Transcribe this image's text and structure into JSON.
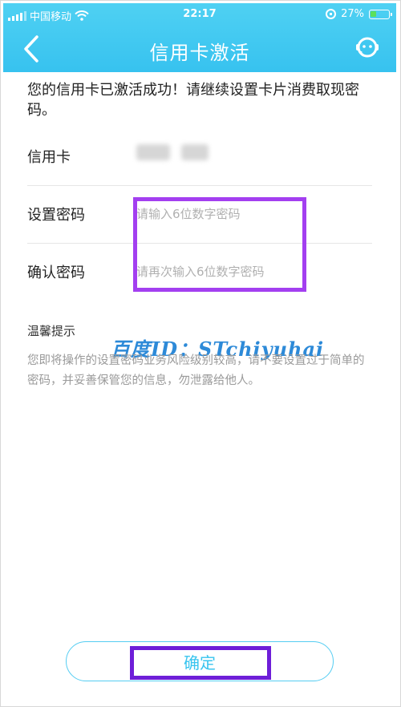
{
  "status_bar": {
    "carrier": "中国移动",
    "time": "22:17",
    "battery": "27%",
    "battery_fraction": 0.27,
    "battery_color": "#5ce05c"
  },
  "nav": {
    "title": "信用卡激活",
    "back_icon": "chevron-left-icon",
    "service_icon": "customer-service-icon",
    "accent": "#37c2ef"
  },
  "message": "您的信用卡已激活成功！请继续设置卡片消费取现密码。",
  "form": {
    "card_label": "信用卡",
    "set_password_label": "设置密码",
    "set_password_placeholder": "请输入6位数字密码",
    "confirm_password_label": "确认密码",
    "confirm_password_placeholder": "请再次输入6位数字密码"
  },
  "tips": {
    "title": "温馨提示",
    "body": "您即将操作的设置密码业务风险级别较高，请不要设置过于简单的密码，并妥善保管您的信息，勿泄露给他人。"
  },
  "watermark": "百度ID：STchiyuhai",
  "confirm_button": "确定",
  "annotation_color": "#a33ff0"
}
